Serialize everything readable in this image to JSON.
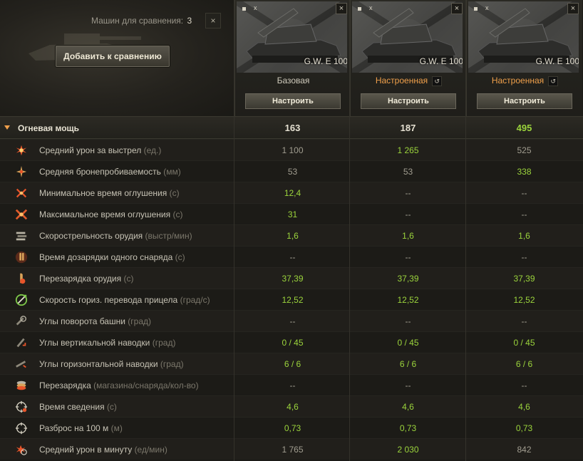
{
  "header": {
    "compare_label": "Машин для сравнения:",
    "compare_count": "3",
    "clear_icon": "×",
    "add_button": "Добавить к сравнению"
  },
  "vehicles": [
    {
      "name": "G.W. E 100",
      "tag": "x",
      "close": "×",
      "config": "Базовая",
      "config_custom": false,
      "tune_button": "Настроить"
    },
    {
      "name": "G.W. E 100",
      "tag": "x",
      "close": "×",
      "config": "Настроенная",
      "config_custom": true,
      "undo_icon": "↺",
      "tune_button": "Настроить"
    },
    {
      "name": "G.W. E 100",
      "tag": "x",
      "close": "×",
      "config": "Настроенная",
      "config_custom": true,
      "undo_icon": "↺",
      "tune_button": "Настроить"
    }
  ],
  "section": {
    "title": "Огневая мощь",
    "values": [
      "163",
      "187",
      "495"
    ],
    "highlight": [
      false,
      false,
      true
    ]
  },
  "rows": [
    {
      "icon": "shell-burst-icon",
      "label": "Средний урон за выстрел",
      "unit": "(ед.)",
      "values": [
        "1 100",
        "1 265",
        "525"
      ],
      "highlight": [
        false,
        true,
        false
      ]
    },
    {
      "icon": "penetration-icon",
      "label": "Средняя бронепробиваемость",
      "unit": "(мм)",
      "values": [
        "53",
        "53",
        "338"
      ],
      "highlight": [
        false,
        false,
        true
      ]
    },
    {
      "icon": "stun-min-icon",
      "label": "Минимальное время оглушения",
      "unit": "(с)",
      "values": [
        "12,4",
        "--",
        "--"
      ],
      "highlight": [
        true,
        false,
        false
      ]
    },
    {
      "icon": "stun-max-icon",
      "label": "Максимальное время оглушения",
      "unit": "(с)",
      "values": [
        "31",
        "--",
        "--"
      ],
      "highlight": [
        true,
        false,
        false
      ]
    },
    {
      "icon": "rate-of-fire-icon",
      "label": "Скорострельность орудия",
      "unit": "(выстр/мин)",
      "values": [
        "1,6",
        "1,6",
        "1,6"
      ],
      "highlight": [
        true,
        true,
        true
      ]
    },
    {
      "icon": "shell-reload-icon",
      "label": "Время дозарядки одного снаряда",
      "unit": "(с)",
      "values": [
        "--",
        "--",
        "--"
      ],
      "highlight": [
        false,
        false,
        false
      ]
    },
    {
      "icon": "reload-icon",
      "label": "Перезарядка орудия",
      "unit": "(с)",
      "values": [
        "37,39",
        "37,39",
        "37,39"
      ],
      "highlight": [
        true,
        true,
        true
      ]
    },
    {
      "icon": "traverse-speed-icon",
      "label": "Скорость гориз. перевода прицела",
      "unit": "(град/с)",
      "values": [
        "12,52",
        "12,52",
        "12,52"
      ],
      "highlight": [
        true,
        true,
        true
      ]
    },
    {
      "icon": "turret-angles-icon",
      "label": "Углы поворота башни",
      "unit": "(град)",
      "values": [
        "--",
        "--",
        "--"
      ],
      "highlight": [
        false,
        false,
        false
      ]
    },
    {
      "icon": "elevation-icon",
      "label": "Углы вертикальной наводки",
      "unit": "(град)",
      "values": [
        "0 / 45",
        "0 / 45",
        "0 / 45"
      ],
      "highlight": [
        true,
        true,
        true
      ]
    },
    {
      "icon": "horizontal-angles-icon",
      "label": "Углы горизонтальной наводки",
      "unit": "(град)",
      "values": [
        "6 / 6",
        "6 / 6",
        "6 / 6"
      ],
      "highlight": [
        true,
        true,
        true
      ]
    },
    {
      "icon": "magazine-icon",
      "label": "Перезарядка",
      "unit": "(магазина/снаряда/кол-во)",
      "values": [
        "--",
        "--",
        "--"
      ],
      "highlight": [
        false,
        false,
        false
      ]
    },
    {
      "icon": "aim-time-icon",
      "label": "Время сведения",
      "unit": "(с)",
      "values": [
        "4,6",
        "4,6",
        "4,6"
      ],
      "highlight": [
        true,
        true,
        true
      ]
    },
    {
      "icon": "dispersion-icon",
      "label": "Разброс на 100 м",
      "unit": "(м)",
      "values": [
        "0,73",
        "0,73",
        "0,73"
      ],
      "highlight": [
        true,
        true,
        true
      ]
    },
    {
      "icon": "damage-per-minute-icon",
      "label": "Средний урон в минуту",
      "unit": "(ед/мин)",
      "values": [
        "1 765",
        "2 030",
        "842"
      ],
      "highlight": [
        false,
        true,
        false
      ]
    }
  ],
  "colors": {
    "highlight": "#9bd43c",
    "custom_config": "#f0a04b",
    "section_caret": "#f0a04b"
  }
}
